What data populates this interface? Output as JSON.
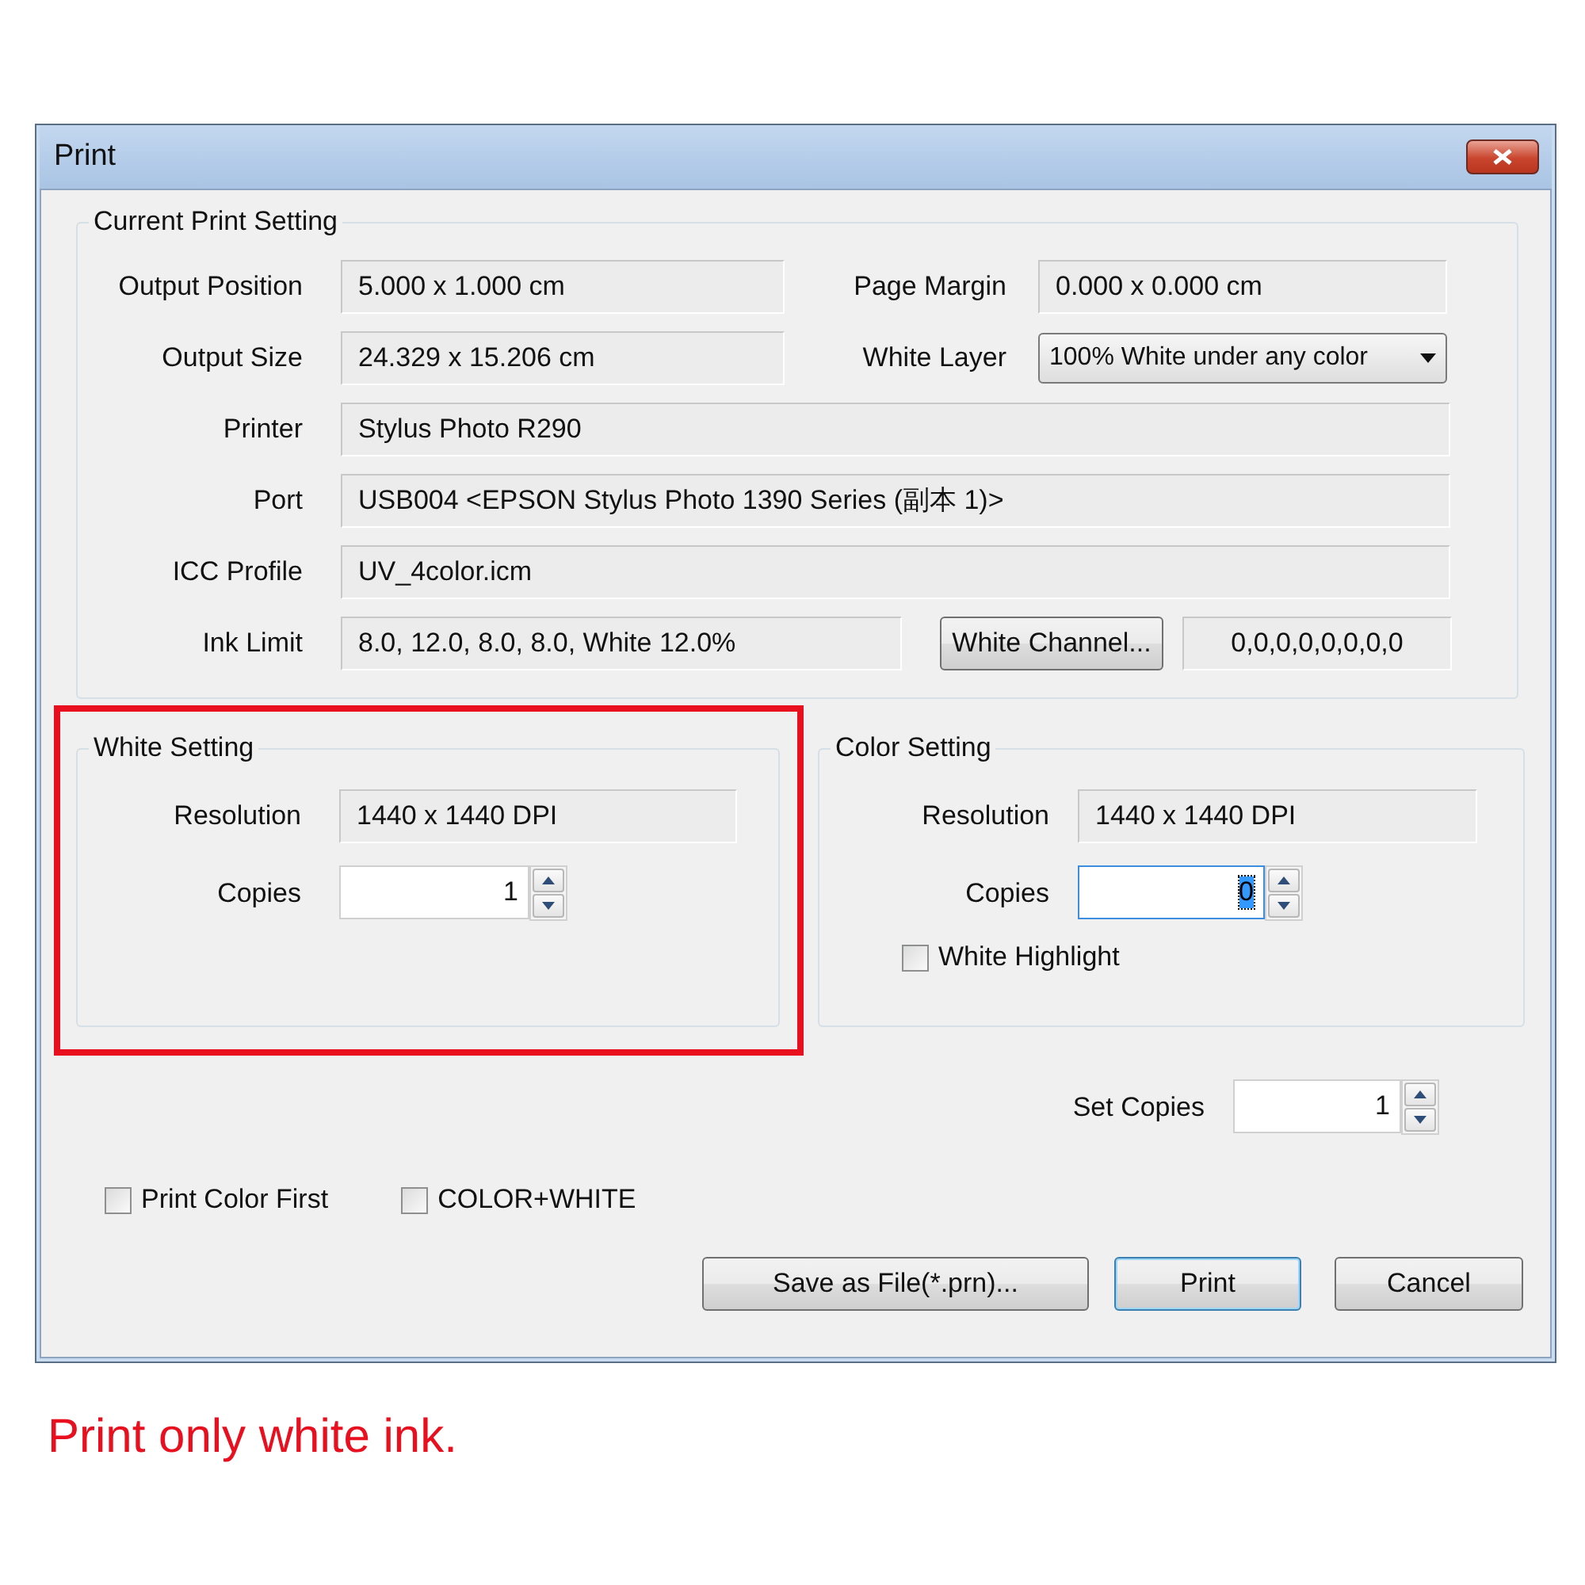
{
  "window": {
    "title": "Print"
  },
  "current_print_setting": {
    "title": "Current Print Setting",
    "output_position": {
      "label": "Output Position",
      "value": "5.000 x 1.000 cm"
    },
    "page_margin": {
      "label": "Page Margin",
      "value": "0.000 x 0.000 cm"
    },
    "output_size": {
      "label": "Output Size",
      "value": "24.329 x 15.206 cm"
    },
    "white_layer": {
      "label": "White Layer",
      "value": "100% White under any color"
    },
    "printer": {
      "label": "Printer",
      "value": "Stylus Photo R290"
    },
    "port": {
      "label": "Port",
      "value": "USB004  <EPSON Stylus Photo 1390 Series (副本 1)>"
    },
    "icc_profile": {
      "label": "ICC Profile",
      "value": "UV_4color.icm"
    },
    "ink_limit": {
      "label": "Ink Limit",
      "value": "8.0, 12.0, 8.0, 8.0, White 12.0%"
    },
    "white_channel_button": "White Channel...",
    "channel_values": "0,0,0,0,0,0,0,0"
  },
  "white_setting": {
    "title": "White Setting",
    "highlighted": true,
    "resolution": {
      "label": "Resolution",
      "value": "1440 x 1440 DPI"
    },
    "copies": {
      "label": "Copies",
      "value": "1",
      "focused": false
    }
  },
  "color_setting": {
    "title": "Color Setting",
    "resolution": {
      "label": "Resolution",
      "value": "1440 x 1440 DPI"
    },
    "copies": {
      "label": "Copies",
      "value": "0",
      "focused": true
    },
    "white_highlight": {
      "label": "White Highlight",
      "checked": false
    }
  },
  "set_copies": {
    "label": "Set Copies",
    "value": "1"
  },
  "options": [
    {
      "label": "Print Color First",
      "checked": false
    },
    {
      "label": "COLOR+WHITE",
      "checked": false
    }
  ],
  "buttons": [
    {
      "label": "Save as File(*.prn)...",
      "default": false
    },
    {
      "label": "Print",
      "default": true
    },
    {
      "label": "Cancel",
      "default": false
    }
  ],
  "caption": "Print only white ink."
}
